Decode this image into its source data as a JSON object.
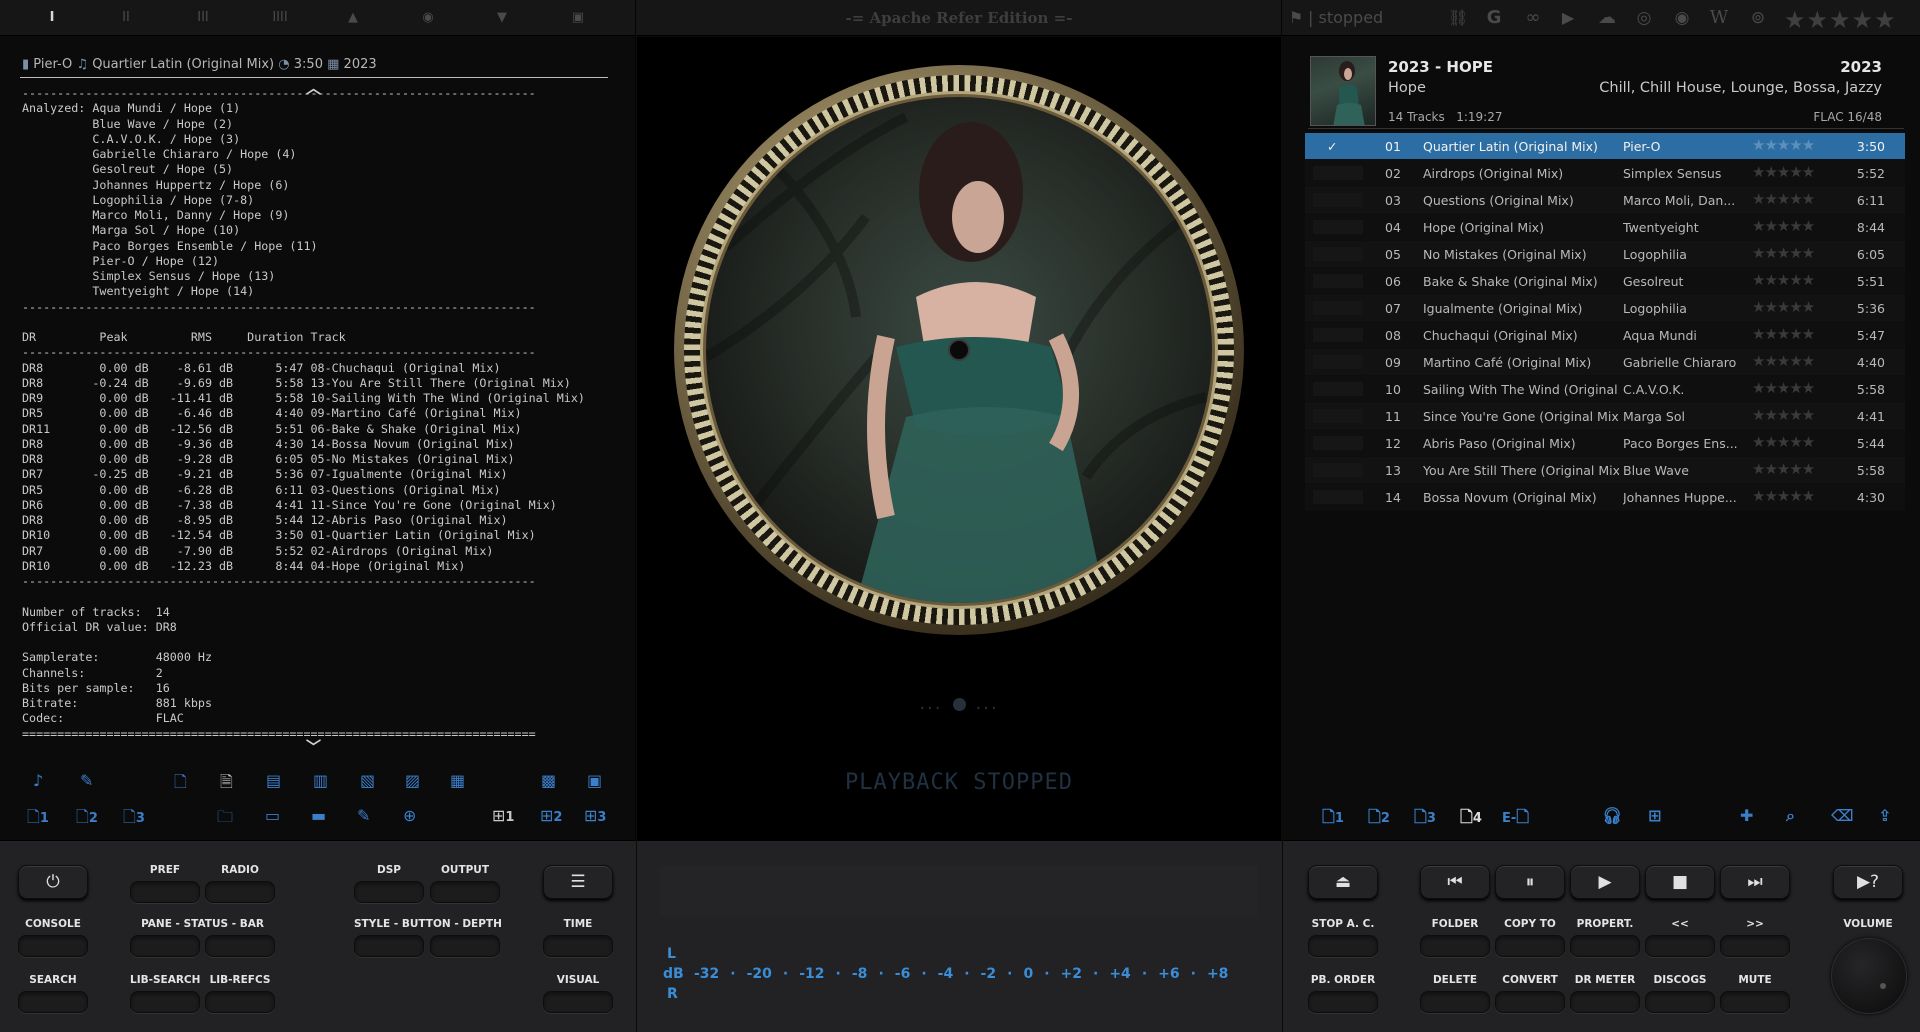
{
  "topbar": {
    "edition": "-= Apache Refer Edition =-",
    "status": "| stopped",
    "rating_stars": "★★★★★",
    "layout_icons": [
      "I",
      "II",
      "III",
      "IIII",
      "▲",
      "◉",
      "▼",
      "▣"
    ],
    "service_icons": [
      "link-icon",
      "google-icon",
      "lastfm-icon",
      "youtube-icon",
      "soundcloud-icon",
      "spotify-icon",
      "discogs-icon",
      "wikipedia-icon",
      "podcast-icon"
    ],
    "service_glyphs": [
      "⛓",
      "G",
      "∞",
      "▶",
      "☁",
      "◎",
      "◉",
      "W",
      "⊚"
    ]
  },
  "now_playing": {
    "artist": "Pier-O",
    "title": "Quartier Latin (Original Mix)",
    "duration": "3:50",
    "year": "2023"
  },
  "log_text": "-------------------------------------------------------------------------\nAnalyzed: Aqua Mundi / Hope (1)\n          Blue Wave / Hope (2)\n          C.A.V.O.K. / Hope (3)\n          Gabrielle Chiararo / Hope (4)\n          Gesolreut / Hope (5)\n          Johannes Huppertz / Hope (6)\n          Logophilia / Hope (7-8)\n          Marco Moli, Danny / Hope (9)\n          Marga Sol / Hope (10)\n          Paco Borges Ensemble / Hope (11)\n          Pier-O / Hope (12)\n          Simplex Sensus / Hope (13)\n          Twentyeight / Hope (14)\n-------------------------------------------------------------------------\n\nDR         Peak         RMS     Duration Track\n-------------------------------------------------------------------------\nDR8        0.00 dB    -8.61 dB      5:47 08-Chuchaqui (Original Mix)\nDR8       -0.24 dB    -9.69 dB      5:58 13-You Are Still There (Original Mix)\nDR9        0.00 dB   -11.41 dB      5:58 10-Sailing With The Wind (Original Mix)\nDR5        0.00 dB    -6.46 dB      4:40 09-Martino Café (Original Mix)\nDR11       0.00 dB   -12.56 dB      5:51 06-Bake & Shake (Original Mix)\nDR8        0.00 dB    -9.36 dB      4:30 14-Bossa Novum (Original Mix)\nDR8        0.00 dB    -9.28 dB      6:05 05-No Mistakes (Original Mix)\nDR7       -0.25 dB    -9.21 dB      5:36 07-Igualmente (Original Mix)\nDR5        0.00 dB    -6.28 dB      6:11 03-Questions (Original Mix)\nDR6        0.00 dB    -7.38 dB      4:41 11-Since You're Gone (Original Mix)\nDR8        0.00 dB    -8.95 dB      5:44 12-Abris Paso (Original Mix)\nDR10       0.00 dB   -12.54 dB      3:50 01-Quartier Latin (Original Mix)\nDR7        0.00 dB    -7.90 dB      5:52 02-Airdrops (Original Mix)\nDR10       0.00 dB   -12.23 dB      8:44 04-Hope (Original Mix)\n-------------------------------------------------------------------------\n\nNumber of tracks:  14\nOfficial DR value: DR8\n\nSamplerate:        48000 Hz\nChannels:          2\nBits per sample:   16\nBitrate:           881 kbps\nCodec:             FLAC\n=========================================================================",
  "left_tools_row2": [
    "1",
    "2",
    "3",
    "1",
    "2",
    "3"
  ],
  "center": {
    "dots_left": "...",
    "dots_right": "...",
    "status": "PLAYBACK STOPPED"
  },
  "album": {
    "title": "2023 - HOPE",
    "year": "2023",
    "artist": "Hope",
    "genre": "Chill, Chill House, Lounge, Bossa, Jazzy",
    "tracks_count": "14 Tracks",
    "total": "1:19:27",
    "format": "FLAC  16/48"
  },
  "tracks": [
    {
      "n": "01",
      "title": "Quartier Latin (Original Mix)",
      "artist": "Pier-O",
      "dur": "3:50",
      "selected": true,
      "check": "✓"
    },
    {
      "n": "02",
      "title": "Airdrops (Original Mix)",
      "artist": "Simplex Sensus",
      "dur": "5:52"
    },
    {
      "n": "03",
      "title": "Questions (Original Mix)",
      "artist": "Marco Moli, Dan...",
      "dur": "6:11"
    },
    {
      "n": "04",
      "title": "Hope (Original Mix)",
      "artist": "Twentyeight",
      "dur": "8:44"
    },
    {
      "n": "05",
      "title": "No Mistakes (Original Mix)",
      "artist": "Logophilia",
      "dur": "6:05"
    },
    {
      "n": "06",
      "title": "Bake & Shake (Original Mix)",
      "artist": "Gesolreut",
      "dur": "5:51"
    },
    {
      "n": "07",
      "title": "Igualmente (Original Mix)",
      "artist": "Logophilia",
      "dur": "5:36"
    },
    {
      "n": "08",
      "title": "Chuchaqui (Original Mix)",
      "artist": "Aqua Mundi",
      "dur": "5:47"
    },
    {
      "n": "09",
      "title": "Martino Café (Original Mix)",
      "artist": "Gabrielle Chiararo",
      "dur": "4:40"
    },
    {
      "n": "10",
      "title": "Sailing With The Wind (Original...",
      "artist": "C.A.V.O.K.",
      "dur": "5:58"
    },
    {
      "n": "11",
      "title": "Since You're Gone (Original Mix)",
      "artist": "Marga Sol",
      "dur": "4:41"
    },
    {
      "n": "12",
      "title": "Abris Paso (Original Mix)",
      "artist": "Paco Borges Ens...",
      "dur": "5:44"
    },
    {
      "n": "13",
      "title": "You Are Still There (Original Mix)",
      "artist": "Blue Wave",
      "dur": "5:58"
    },
    {
      "n": "14",
      "title": "Bossa Novum (Original Mix)",
      "artist": "Johannes Huppe...",
      "dur": "4:30"
    }
  ],
  "rating_glyphs": "★★★★★",
  "right_tools": [
    "1",
    "2",
    "3",
    "4",
    "E-"
  ],
  "controls_left": {
    "power": "⏻",
    "pref": "PREF",
    "radio": "RADIO",
    "dsp": "DSP",
    "output": "OUTPUT",
    "menu": "☰",
    "console": "CONSOLE",
    "pane": "PANE - STATUS - BAR",
    "style": "STYLE - BUTTON - DEPTH",
    "time": "TIME",
    "search": "SEARCH",
    "libsearch": "LIB-SEARCH",
    "librefcs": "LIB-REFCS",
    "visual": "VISUAL"
  },
  "meter": {
    "L": "L",
    "dB": "dB",
    "R": "R",
    "scale": [
      "-32",
      "-20",
      "-12",
      "-8",
      "-6",
      "-4",
      "-2",
      "0",
      "+2",
      "+4",
      "+6",
      "+8"
    ]
  },
  "controls_right": {
    "eject": "⏏",
    "prev": "⏮",
    "pause": "⏸",
    "play": "▶",
    "stop": "■",
    "next": "⏭",
    "help": "▶?",
    "stopac": "STOP A. C.",
    "folder": "FOLDER",
    "copyto": "COPY TO",
    "propert": "PROPERT.",
    "back": "<<",
    "fwd": ">>",
    "volume": "VOLUME",
    "pborder": "PB. ORDER",
    "delete": "DELETE",
    "convert": "CONVERT",
    "drmeter": "DR METER",
    "discogs": "DISCOGS",
    "mute": "MUTE"
  }
}
